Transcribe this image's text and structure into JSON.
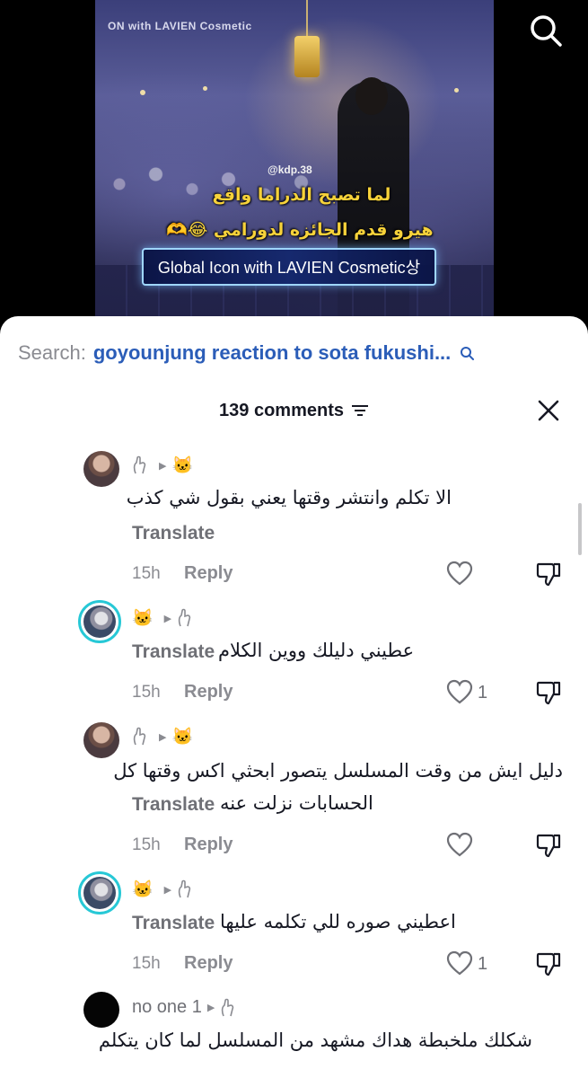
{
  "video": {
    "top_text": "ON with LAVIEN Cosmetic",
    "watermark": "@kdp.38",
    "caption_line1": "لما تصبح الدراما واقع",
    "caption_line2": "هيرو قدم الجائزه لدورامي 😂🫶",
    "award_banner": "Global Icon with LAVIEN Cosmetic상"
  },
  "search": {
    "prefix": "Search:",
    "query": "goyounjung reaction to sota fukushi..."
  },
  "comments_header": {
    "count_label": "139 comments"
  },
  "comments": [
    {
      "text": "الا تكلم وانتشر وقتها يعني بقول شي كذب",
      "translate": "Translate",
      "time": "15h",
      "reply": "Reply",
      "likes": ""
    },
    {
      "text": "عطيني دليلك ووين الكلام",
      "translate": "Translate",
      "time": "15h",
      "reply": "Reply",
      "likes": "1"
    },
    {
      "text_line1": "دليل ايش من وقت المسلسل يتصور ابحثي اكس وقتها كل",
      "text_line2": "الحسابات نزلت عنه",
      "translate": "Translate",
      "time": "15h",
      "reply": "Reply",
      "likes": ""
    },
    {
      "text": "اعطيني صوره للي تكلمه عليها",
      "translate": "Translate",
      "time": "15h",
      "reply": "Reply",
      "likes": "1"
    },
    {
      "author": "no one 1",
      "text": "شكلك ملخبطة هداك مشهد من المسلسل لما كان يتكلم"
    }
  ],
  "colors": {
    "accent_link": "#2b5db8",
    "avatar_ring": "#27c8d6",
    "caption_yellow": "#f7d23a"
  }
}
